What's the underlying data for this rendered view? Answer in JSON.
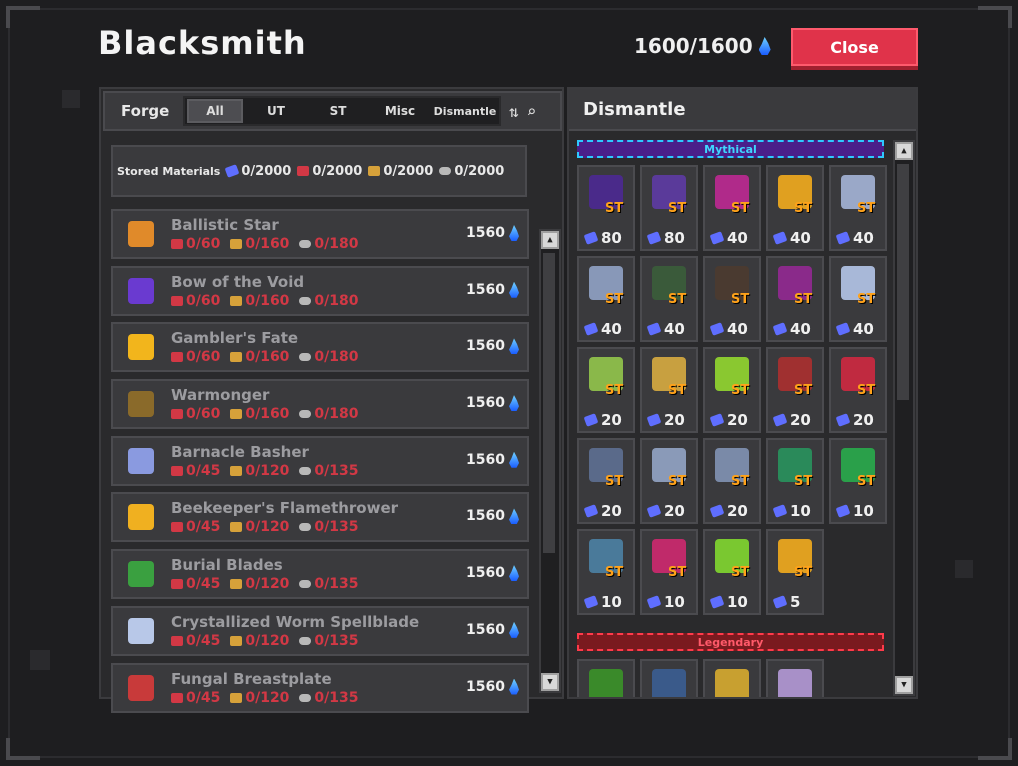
{
  "title": "Blacksmith",
  "mana": "1600/1600",
  "close_label": "Close",
  "forge": {
    "label": "Forge",
    "tabs": [
      "All",
      "UT",
      "ST",
      "Misc",
      "Dismantle"
    ],
    "active_tab": "All"
  },
  "stored": {
    "label": "Stored Materials",
    "materials": [
      {
        "icon": "blue-gem-icon",
        "value": "0/2000",
        "color": "#5f6eff"
      },
      {
        "icon": "red-gem-icon",
        "value": "0/2000",
        "color": "#d23845"
      },
      {
        "icon": "gold-ore-icon",
        "value": "0/2000",
        "color": "#d6a13a"
      },
      {
        "icon": "silver-ore-icon",
        "value": "0/2000",
        "color": "#b8b8b8"
      }
    ]
  },
  "items": [
    {
      "name": "Ballistic Star",
      "req": [
        "0/60",
        "0/160",
        "0/180"
      ],
      "cost": "1560",
      "color": "#e08a2a"
    },
    {
      "name": "Bow of the Void",
      "req": [
        "0/60",
        "0/160",
        "0/180"
      ],
      "cost": "1560",
      "color": "#6a3ad0"
    },
    {
      "name": "Gambler's Fate",
      "req": [
        "0/60",
        "0/160",
        "0/180"
      ],
      "cost": "1560",
      "color": "#f2b51c"
    },
    {
      "name": "Warmonger",
      "req": [
        "0/60",
        "0/160",
        "0/180"
      ],
      "cost": "1560",
      "color": "#8a6a2a"
    },
    {
      "name": "Barnacle Basher",
      "req": [
        "0/45",
        "0/120",
        "0/135"
      ],
      "cost": "1560",
      "color": "#8a9ae0"
    },
    {
      "name": "Beekeeper's Flamethrower",
      "req": [
        "0/45",
        "0/120",
        "0/135"
      ],
      "cost": "1560",
      "color": "#f0b020"
    },
    {
      "name": "Burial Blades",
      "req": [
        "0/45",
        "0/120",
        "0/135"
      ],
      "cost": "1560",
      "color": "#3aa040"
    },
    {
      "name": "Crystallized Worm Spellblade",
      "req": [
        "0/45",
        "0/120",
        "0/135"
      ],
      "cost": "1560",
      "color": "#b8c8e8"
    },
    {
      "name": "Fungal Breastplate",
      "req": [
        "0/45",
        "0/120",
        "0/135"
      ],
      "cost": "1560",
      "color": "#c83a3a"
    }
  ],
  "dismantle": {
    "title": "Dismantle",
    "mythical_label": "Mythical",
    "legendary_label": "Legendary",
    "st_label": "ST",
    "mythical": [
      {
        "count": "80",
        "color": "#4a2a8a"
      },
      {
        "count": "80",
        "color": "#5a3a9a"
      },
      {
        "count": "40",
        "color": "#b02a8a"
      },
      {
        "count": "40",
        "color": "#e0a020"
      },
      {
        "count": "40",
        "color": "#9aa8c8"
      },
      {
        "count": "40",
        "color": "#8898b8"
      },
      {
        "count": "40",
        "color": "#3a5a3a"
      },
      {
        "count": "40",
        "color": "#4a3a30"
      },
      {
        "count": "40",
        "color": "#8a2a8a"
      },
      {
        "count": "40",
        "color": "#a8b8d8"
      },
      {
        "count": "20",
        "color": "#8ab84a"
      },
      {
        "count": "20",
        "color": "#c8a040"
      },
      {
        "count": "20",
        "color": "#8ac830"
      },
      {
        "count": "20",
        "color": "#a03030"
      },
      {
        "count": "20",
        "color": "#c02a40"
      },
      {
        "count": "20",
        "color": "#5a6a8a"
      },
      {
        "count": "20",
        "color": "#8a9ab8"
      },
      {
        "count": "20",
        "color": "#7a8aa8"
      },
      {
        "count": "10",
        "color": "#2a8a5a"
      },
      {
        "count": "10",
        "color": "#2aa04a"
      },
      {
        "count": "10",
        "color": "#4a7a9a"
      },
      {
        "count": "10",
        "color": "#c02a6a"
      },
      {
        "count": "10",
        "color": "#7ac830"
      },
      {
        "count": "5",
        "color": "#e0a020"
      }
    ],
    "legendary": [
      {
        "color": "#3a8a2a"
      },
      {
        "color": "#3a5a8a"
      },
      {
        "color": "#c8a030"
      },
      {
        "color": "#a890c8"
      }
    ]
  }
}
